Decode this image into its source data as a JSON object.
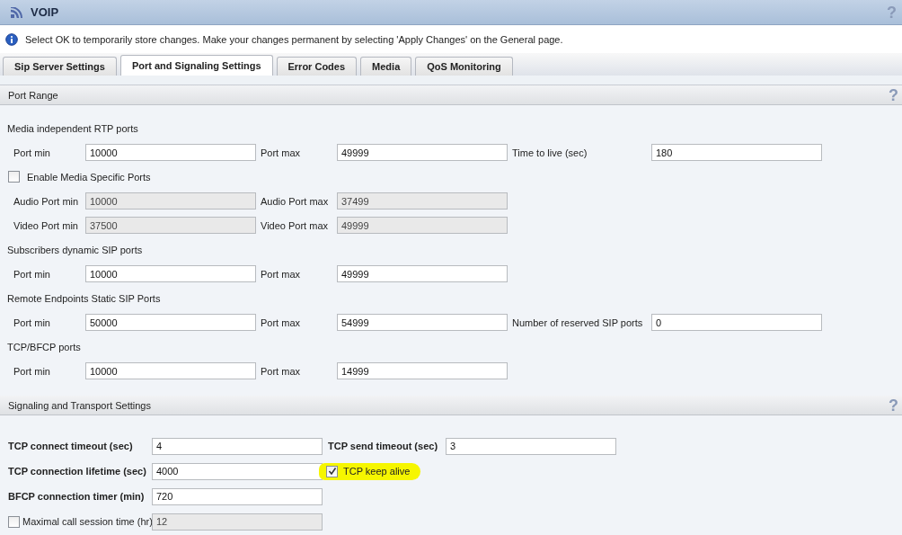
{
  "window": {
    "title": "VOIP",
    "help": "?"
  },
  "info": "Select OK to temporarily store changes. Make your changes permanent by selecting 'Apply Changes' on the General page.",
  "tabs": [
    {
      "label": "Sip Server Settings",
      "selected": false
    },
    {
      "label": "Port and Signaling Settings",
      "selected": true
    },
    {
      "label": "Error Codes",
      "selected": false
    },
    {
      "label": "Media",
      "selected": false
    },
    {
      "label": "QoS Monitoring",
      "selected": false
    }
  ],
  "port_range": {
    "title": "Port Range",
    "help": "?",
    "groups": [
      {
        "kind": "heading",
        "label": "Media independent RTP ports"
      },
      {
        "kind": "fields",
        "fields": [
          {
            "label": "Port min",
            "value": "10000",
            "disabled": false
          },
          {
            "label": "Port max",
            "value": "49999",
            "disabled": false
          },
          {
            "label": "Time to live (sec)",
            "value": "180",
            "disabled": false
          }
        ]
      },
      {
        "kind": "checkbox",
        "label": "Enable Media Specific Ports",
        "checked": false
      },
      {
        "kind": "fields",
        "fields": [
          {
            "label": "Audio Port min",
            "value": "10000",
            "disabled": true
          },
          {
            "label": "Audio Port max",
            "value": "37499",
            "disabled": true
          }
        ]
      },
      {
        "kind": "fields",
        "fields": [
          {
            "label": "Video Port min",
            "value": "37500",
            "disabled": true
          },
          {
            "label": "Video Port max",
            "value": "49999",
            "disabled": true
          }
        ]
      },
      {
        "kind": "heading",
        "label": "Subscribers dynamic SIP ports"
      },
      {
        "kind": "fields",
        "fields": [
          {
            "label": "Port min",
            "value": "10000",
            "disabled": false
          },
          {
            "label": "Port max",
            "value": "49999",
            "disabled": false
          }
        ]
      },
      {
        "kind": "heading",
        "label": "Remote Endpoints Static SIP Ports"
      },
      {
        "kind": "fields",
        "fields": [
          {
            "label": "Port min",
            "value": "50000",
            "disabled": false
          },
          {
            "label": "Port max",
            "value": "54999",
            "disabled": false
          },
          {
            "label": "Number of reserved SIP ports",
            "value": "0",
            "disabled": false
          }
        ]
      },
      {
        "kind": "heading",
        "label": "TCP/BFCP ports"
      },
      {
        "kind": "fields",
        "fields": [
          {
            "label": "Port min",
            "value": "10000",
            "disabled": false
          },
          {
            "label": "Port max",
            "value": "14999",
            "disabled": false
          }
        ]
      }
    ]
  },
  "signaling": {
    "title": "Signaling and Transport Settings",
    "help": "?",
    "rows": [
      [
        {
          "kind": "field",
          "label": "TCP connect timeout (sec)",
          "value": "4",
          "disabled": false
        },
        {
          "kind": "field",
          "label": "TCP send timeout (sec)",
          "value": "3",
          "disabled": false
        }
      ],
      [
        {
          "kind": "field",
          "label": "TCP connection lifetime (sec)",
          "value": "4000",
          "disabled": false
        },
        {
          "kind": "checkbox",
          "label": "TCP keep alive",
          "checked": true,
          "highlighted": true
        }
      ],
      [
        {
          "kind": "field",
          "label": "BFCP connection timer (min)",
          "value": "720",
          "disabled": false
        }
      ],
      [
        {
          "kind": "checkfield",
          "label": "Maximal call session time (hr)",
          "checked": false,
          "value": "12",
          "disabled": true
        }
      ]
    ]
  }
}
